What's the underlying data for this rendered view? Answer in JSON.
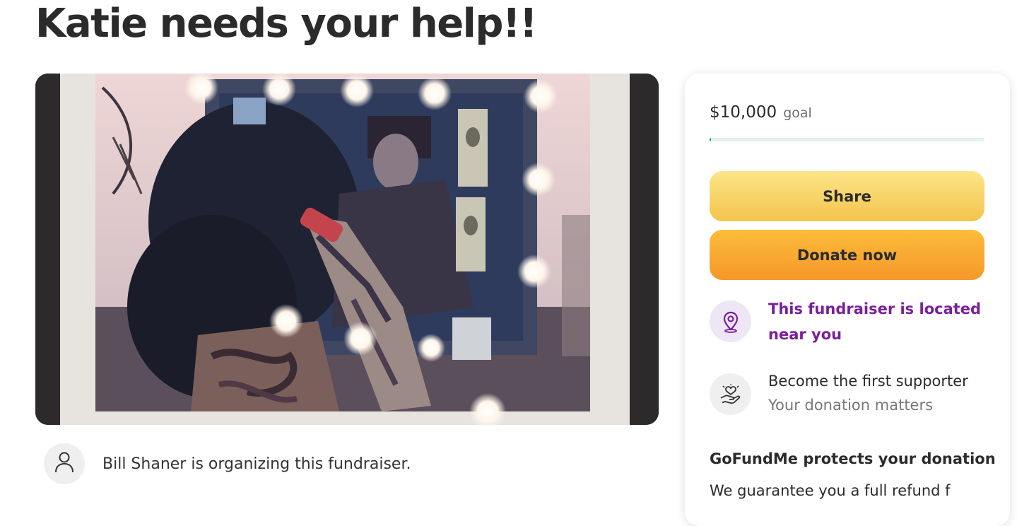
{
  "page": {
    "title": "Katie needs your help!!"
  },
  "organizer": {
    "text": "Bill Shaner is organizing this fundraiser."
  },
  "card": {
    "goal_amount": "$10,000",
    "goal_label": "goal",
    "progress_fraction": 0.005,
    "share_label": "Share",
    "donate_label": "Donate now",
    "location_text": "This fundraiser is located near you",
    "supporter_title": "Become the first supporter",
    "supporter_subtitle": "Your donation matters",
    "protects_heading": "GoFundMe protects your donation",
    "protects_body": "We guarantee you a full refund f"
  },
  "colors": {
    "progress": "#02a95c",
    "share": "#f3c44d",
    "donate": "#f6972a",
    "location_accent": "#7a1f9c"
  },
  "icons": {
    "organizer": "person-icon",
    "location": "map-pin-icon",
    "supporter": "heart-hand-icon"
  }
}
